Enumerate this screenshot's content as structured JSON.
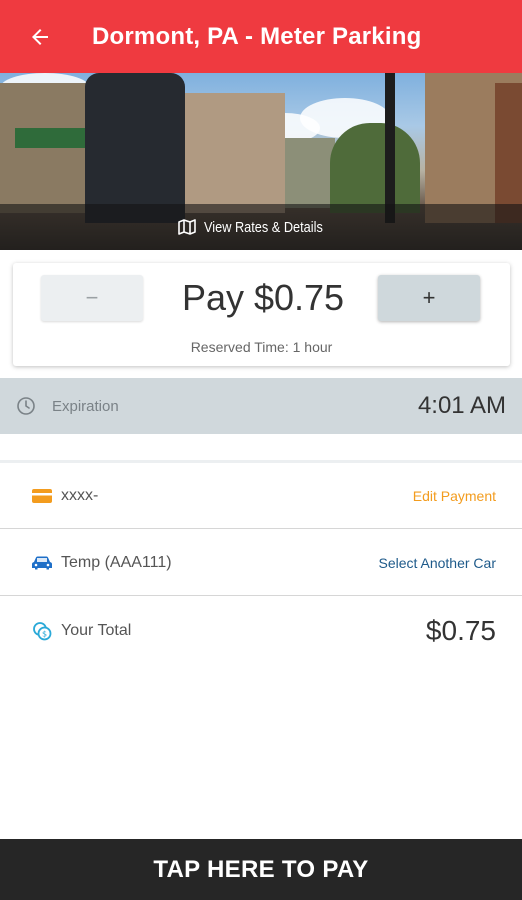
{
  "app_bar": {
    "title": "Dormont, PA - Meter Parking",
    "color": "#ef3a40"
  },
  "hero": {
    "link_label": "View Rates & Details",
    "link_icon": "map-icon"
  },
  "pay_card": {
    "decrement_label": "−",
    "increment_label": "+",
    "pay_text": "Pay $0.75",
    "reserved_time": "Reserved Time: 1 hour"
  },
  "expiration": {
    "icon": "clock-icon",
    "label": "Expiration",
    "time": "4:01 AM"
  },
  "payment": {
    "icon": "credit-card-icon",
    "card_text": "xxxx-",
    "action": "Edit Payment",
    "action_color": "#f39c1e"
  },
  "vehicle": {
    "icon": "car-icon",
    "text": "Temp (AAA111)",
    "action": "Select Another Car",
    "action_color": "#1e5a8a"
  },
  "total": {
    "icon": "coins-icon",
    "label": "Your Total",
    "value": "$0.75"
  },
  "footer": {
    "button_label": "TAP HERE TO PAY"
  }
}
